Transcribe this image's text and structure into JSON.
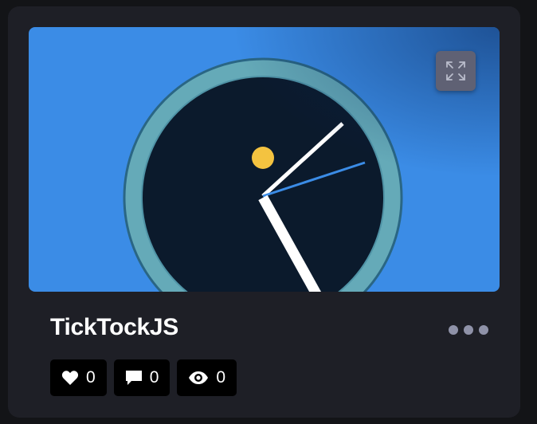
{
  "card": {
    "title": "TickTockJS"
  },
  "preview": {
    "background_color": "#3b8ce6",
    "expand_icon": "expand-arrows-icon",
    "clock": {
      "ring_color": "#65aab8",
      "face_color": "#0b1a2c",
      "hour_hand_color": "#ffffff",
      "minute_hand_color": "#ffffff",
      "second_hand_color": "#3b8ce6",
      "sun_dot_color": "#f4c340"
    }
  },
  "stats": {
    "likes": {
      "icon": "heart-icon",
      "count": "0"
    },
    "comments": {
      "icon": "comment-icon",
      "count": "0"
    },
    "views": {
      "icon": "eye-icon",
      "count": "0"
    }
  },
  "more_menu_icon": "more-dots-icon"
}
